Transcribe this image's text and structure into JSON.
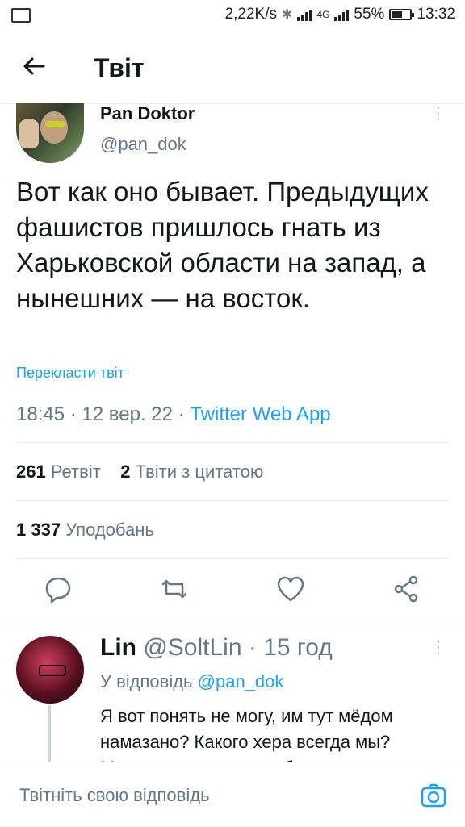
{
  "status_bar": {
    "speed": "2,22K/s",
    "network": "4G",
    "battery_percent": "55%",
    "time": "13:32",
    "icons": [
      "image-icon",
      "bluetooth-icon",
      "signal-icon",
      "battery-icon"
    ]
  },
  "header": {
    "title": "Твіт",
    "back_icon": "arrow-left-icon"
  },
  "tweet": {
    "author_name": "Pan Doktor",
    "author_handle": "@pan_dok",
    "text": "Вот как оно бывает. Предыдущих фашистов пришлось гнать из Харьковской области на запад, а нынешних — на восток.",
    "translate_label": "Перекласти твіт",
    "time": "18:45",
    "date": "12 вер. 22",
    "source": "Twitter Web App",
    "retweets_count": "261",
    "retweets_label": "Ретвіт",
    "quotes_count": "2",
    "quotes_label": "Твіти з цитатою",
    "likes_count": "1 337",
    "likes_label": "Уподобань",
    "actions": [
      "reply-icon",
      "retweet-icon",
      "like-icon",
      "share-icon"
    ]
  },
  "reply": {
    "author_name": "Lin",
    "author_handle": "@SoltLin",
    "time_ago": "15 год",
    "replying_prefix": "У відповідь",
    "replying_handle": "@pan_dok",
    "text": "Я вот понять не могу, им тут мёдом намазано? Какого хера всегда мы? Максимально миролюбивая страна"
  },
  "composer": {
    "placeholder": "Твітніть свою відповідь",
    "camera_icon": "camera-icon"
  },
  "colors": {
    "accent": "#1da1f2",
    "secondary_text": "#657786",
    "divider": "#e6ecf0"
  }
}
